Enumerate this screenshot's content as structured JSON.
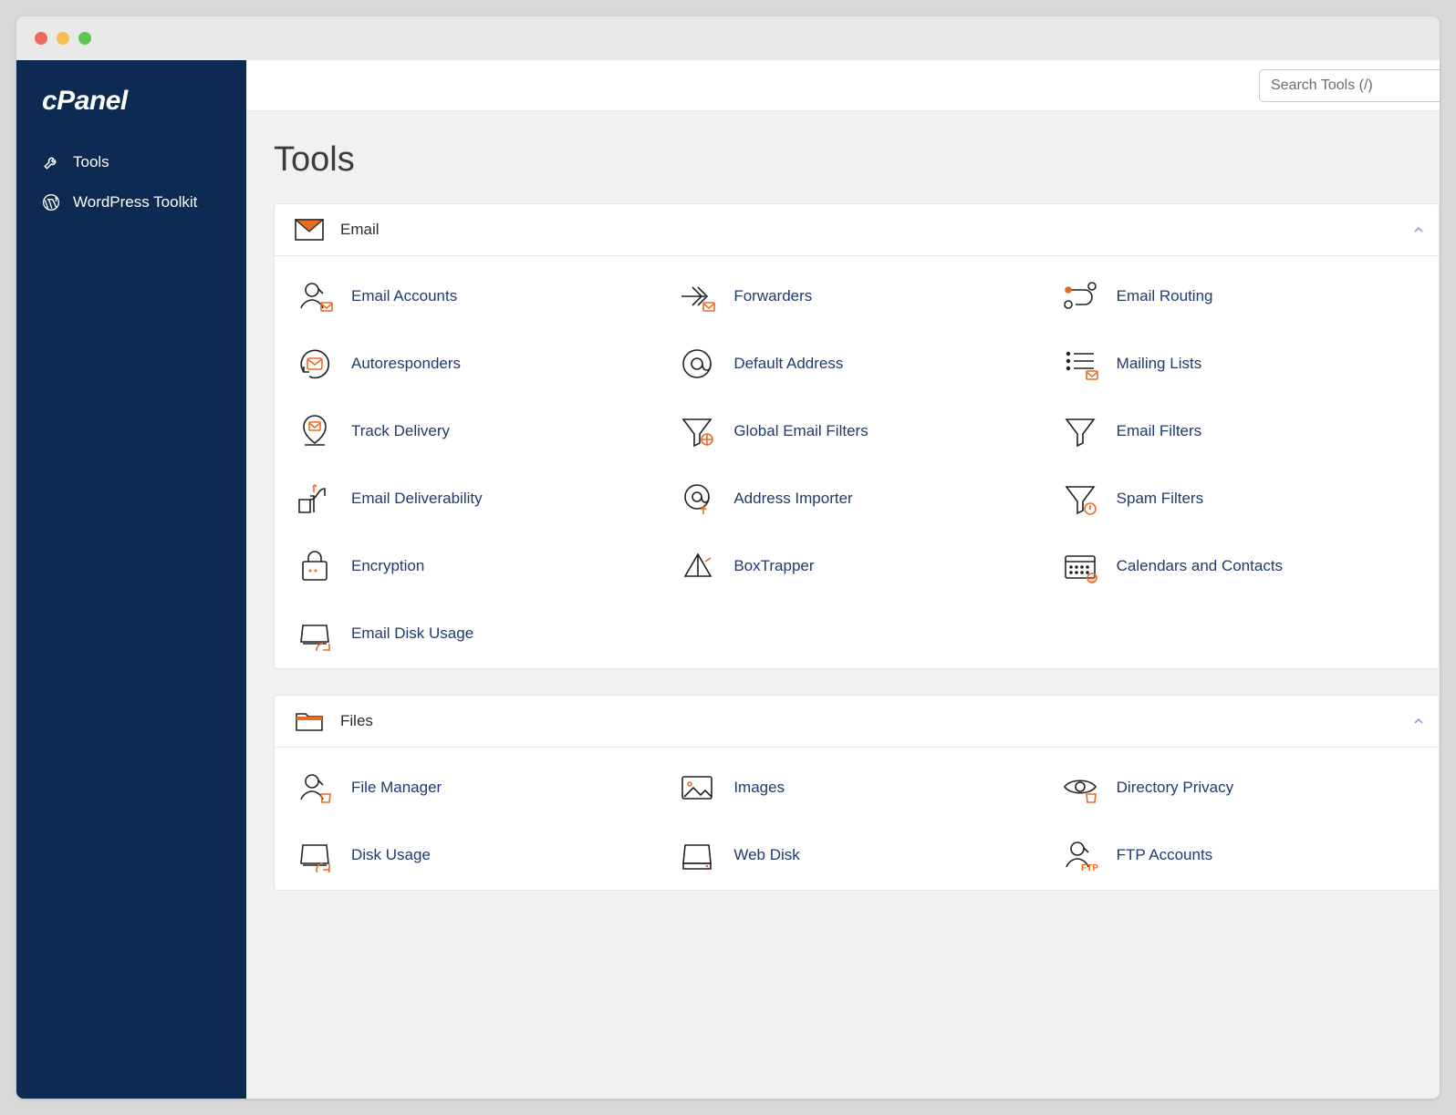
{
  "brand": "cPanel",
  "sidebar": {
    "items": [
      {
        "label": "Tools",
        "icon": "tools-icon"
      },
      {
        "label": "WordPress Toolkit",
        "icon": "wordpress-icon"
      }
    ]
  },
  "search": {
    "placeholder": "Search Tools (/)"
  },
  "page": {
    "title": "Tools"
  },
  "panels": [
    {
      "key": "email",
      "title": "Email",
      "icon": "mail-section-icon",
      "items": [
        {
          "label": "Email Accounts",
          "icon": "email-accounts-icon"
        },
        {
          "label": "Forwarders",
          "icon": "forwarders-icon"
        },
        {
          "label": "Email Routing",
          "icon": "email-routing-icon"
        },
        {
          "label": "Autoresponders",
          "icon": "autoresponders-icon"
        },
        {
          "label": "Default Address",
          "icon": "default-address-icon"
        },
        {
          "label": "Mailing Lists",
          "icon": "mailing-lists-icon"
        },
        {
          "label": "Track Delivery",
          "icon": "track-delivery-icon"
        },
        {
          "label": "Global Email Filters",
          "icon": "global-filters-icon"
        },
        {
          "label": "Email Filters",
          "icon": "email-filters-icon"
        },
        {
          "label": "Email Deliverability",
          "icon": "deliverability-icon"
        },
        {
          "label": "Address Importer",
          "icon": "address-importer-icon"
        },
        {
          "label": "Spam Filters",
          "icon": "spam-filters-icon"
        },
        {
          "label": "Encryption",
          "icon": "encryption-icon"
        },
        {
          "label": "BoxTrapper",
          "icon": "boxtrapper-icon"
        },
        {
          "label": "Calendars and Contacts",
          "icon": "calendars-icon"
        },
        {
          "label": "Email Disk Usage",
          "icon": "email-disk-usage-icon"
        }
      ]
    },
    {
      "key": "files",
      "title": "Files",
      "icon": "folder-section-icon",
      "items": [
        {
          "label": "File Manager",
          "icon": "file-manager-icon"
        },
        {
          "label": "Images",
          "icon": "images-icon"
        },
        {
          "label": "Directory Privacy",
          "icon": "directory-privacy-icon"
        },
        {
          "label": "Disk Usage",
          "icon": "disk-usage-icon"
        },
        {
          "label": "Web Disk",
          "icon": "web-disk-icon"
        },
        {
          "label": "FTP Accounts",
          "icon": "ftp-accounts-icon"
        }
      ]
    }
  ],
  "colors": {
    "accent": "#e86c24",
    "link": "#1f3a6e",
    "sidebar": "#0c2a52"
  }
}
